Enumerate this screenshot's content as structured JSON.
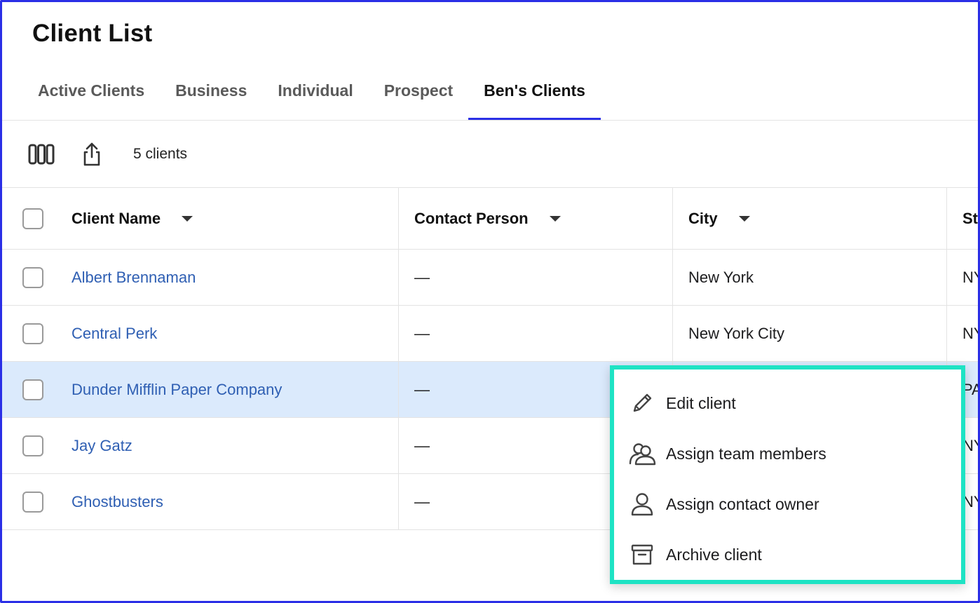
{
  "page": {
    "title": "Client List"
  },
  "tabs": [
    {
      "label": "Active Clients"
    },
    {
      "label": "Business"
    },
    {
      "label": "Individual"
    },
    {
      "label": "Prospect"
    },
    {
      "label": "Ben's Clients",
      "active": true
    }
  ],
  "toolbar": {
    "columns_icon": "columns-icon",
    "export_icon": "share-export-icon",
    "count_label": "5 clients"
  },
  "table": {
    "headers": {
      "name": "Client Name",
      "contact": "Contact Person",
      "city": "City",
      "state": "St"
    },
    "rows": [
      {
        "name": "Albert Brennaman",
        "contact": "—",
        "city": "New York",
        "state": "NY"
      },
      {
        "name": "Central Perk",
        "contact": "—",
        "city": "New York City",
        "state": "NY"
      },
      {
        "name": "Dunder Mifflin Paper Company",
        "contact": "—",
        "city": "",
        "state": "PA"
      },
      {
        "name": "Jay Gatz",
        "contact": "—",
        "city": "",
        "state": "NY"
      },
      {
        "name": "Ghostbusters",
        "contact": "—",
        "city": "",
        "state": "NY"
      }
    ]
  },
  "context_menu": {
    "items": [
      {
        "label": "Edit client",
        "icon": "pencil-icon"
      },
      {
        "label": "Assign team members",
        "icon": "users-icon"
      },
      {
        "label": "Assign contact owner",
        "icon": "user-icon"
      },
      {
        "label": "Archive client",
        "icon": "archive-icon"
      }
    ]
  },
  "colors": {
    "accent": "#2b2fe6",
    "link": "#2f5fb3",
    "highlight_row": "#dbeafc",
    "menu_outline": "#1ee3c4"
  }
}
